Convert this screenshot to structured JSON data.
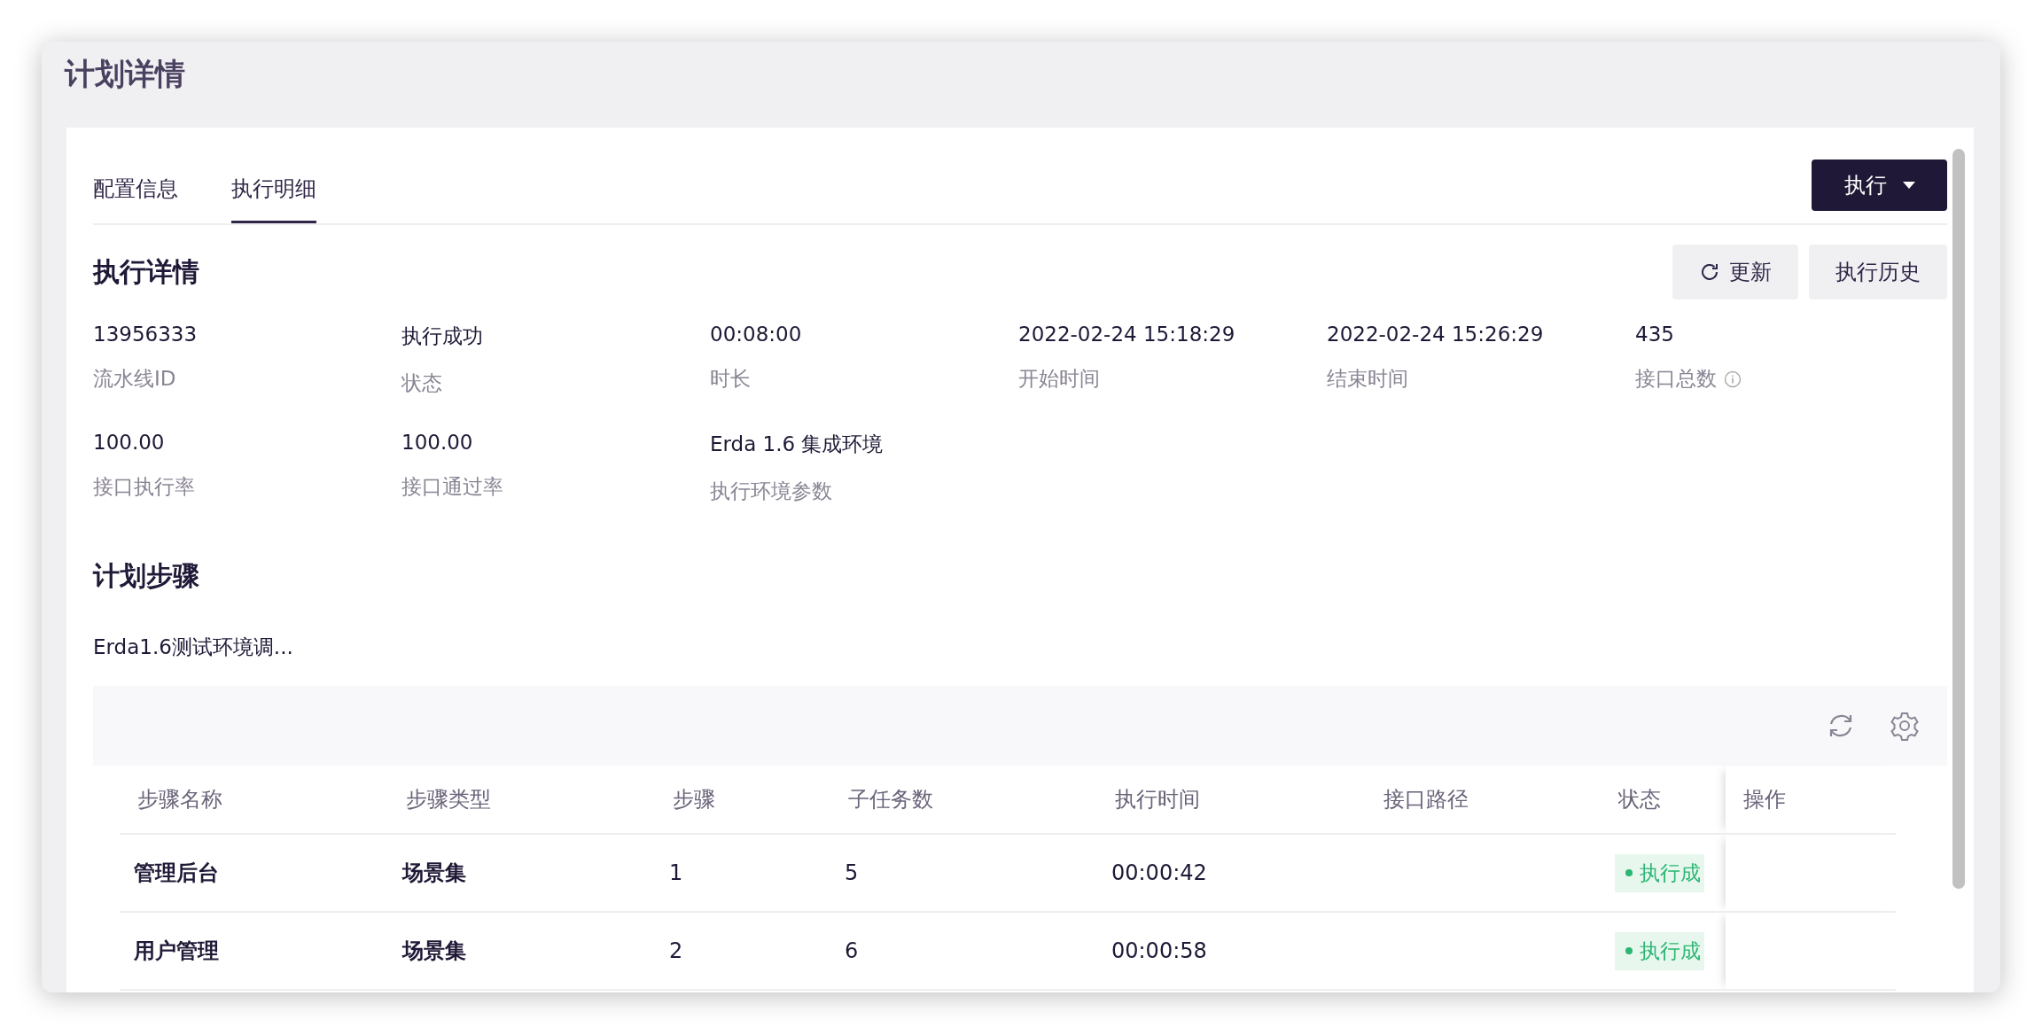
{
  "page": {
    "title": "计划详情"
  },
  "tabs": [
    {
      "label": "配置信息",
      "selected": false
    },
    {
      "label": "执行明细",
      "selected": true
    }
  ],
  "run_button": {
    "label": "执行"
  },
  "details": {
    "title": "执行详情",
    "buttons": [
      {
        "label": "更新",
        "kind": "refresh"
      },
      {
        "label": "执行历史",
        "kind": "plain"
      }
    ],
    "fields": [
      {
        "value": "13956333",
        "label": "流水线ID",
        "info": false
      },
      {
        "value": "执行成功",
        "label": "状态",
        "info": false
      },
      {
        "value": "00:08:00",
        "label": "时长",
        "info": false
      },
      {
        "value": "2022-02-24 15:18:29",
        "label": "开始时间",
        "info": false
      },
      {
        "value": "2022-02-24 15:26:29",
        "label": "结束时间",
        "info": false
      },
      {
        "value": "435",
        "label": "接口总数",
        "info": true
      },
      {
        "value": "100.00",
        "label": "接口执行率",
        "info": false
      },
      {
        "value": "100.00",
        "label": "接口通过率",
        "info": false
      },
      {
        "value": "Erda 1.6 集成环境",
        "label": "执行环境参数",
        "info": false
      }
    ]
  },
  "steps": {
    "title": "计划步骤",
    "plan_name": "Erda1.6测试环境调...",
    "columns": [
      "步骤名称",
      "步骤类型",
      "步骤",
      "子任务数",
      "执行时间",
      "接口路径",
      "状态",
      "操作"
    ],
    "rows": [
      {
        "name": "管理后台",
        "type": "场景集",
        "step": "1",
        "subtasks": "5",
        "time": "00:00:42",
        "status": "执行成"
      },
      {
        "name": "用户管理",
        "type": "场景集",
        "step": "2",
        "subtasks": "6",
        "time": "00:00:58",
        "status": "执行成"
      }
    ]
  }
}
